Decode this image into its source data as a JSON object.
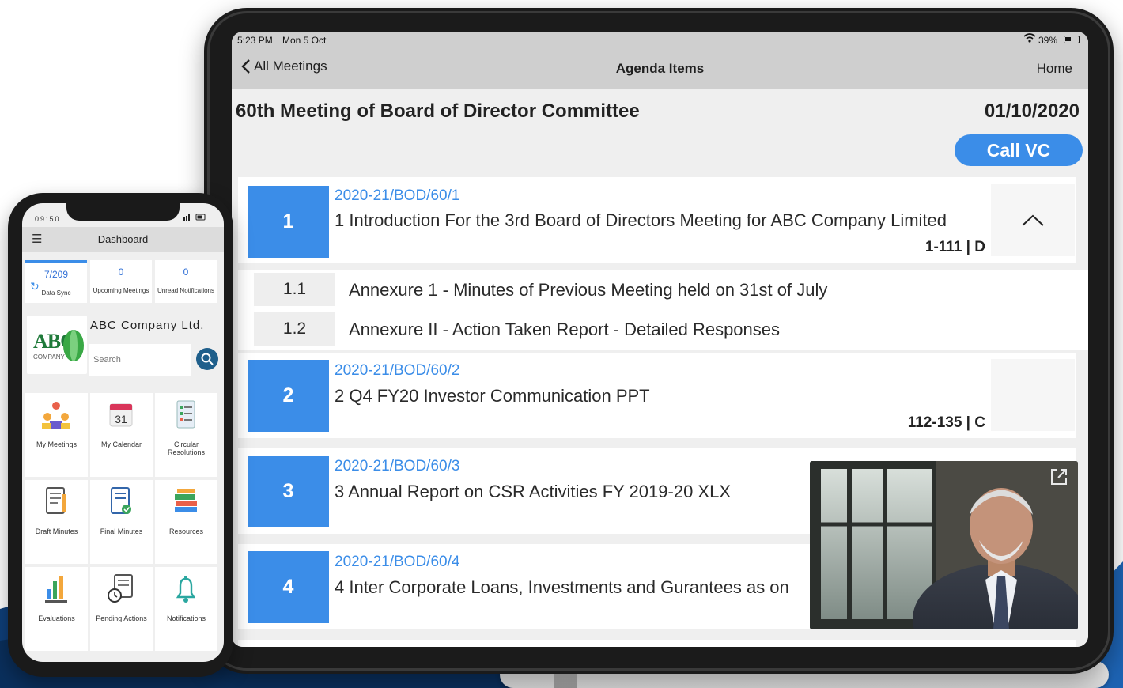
{
  "tablet": {
    "status_bar": {
      "time": "5:23 PM",
      "date": "Mon 5 Oct",
      "battery": "39%"
    },
    "nav": {
      "back_label": "All Meetings",
      "title": "Agenda Items",
      "home_label": "Home"
    },
    "meeting": {
      "title": "60th Meeting of Board of Director Committee",
      "date": "01/10/2020",
      "call_vc_label": "Call VC"
    },
    "agenda_items": [
      {
        "number": "1",
        "ref": "2020-21/BOD/60/1",
        "title": "1 Introduction For the 3rd Board of Directors Meeting for ABC Company Limited",
        "pages": "1-111 | D",
        "expanded": true,
        "sub_items": [
          {
            "number": "1.1",
            "title": "Annexure 1 - Minutes of Previous Meeting held on 31st of July"
          },
          {
            "number": "1.2",
            "title": "Annexure II - Action Taken Report - Detailed Responses"
          }
        ]
      },
      {
        "number": "2",
        "ref": "2020-21/BOD/60/2",
        "title": "2 Q4 FY20 Investor Communication PPT",
        "pages": "112-135 | C"
      },
      {
        "number": "3",
        "ref": "2020-21/BOD/60/3",
        "title": "3 Annual Report on CSR Activities FY 2019-20 XLX"
      },
      {
        "number": "4",
        "ref": "2020-21/BOD/60/4",
        "title": "4 Inter Corporate Loans, Investments and Gurantees as on"
      }
    ],
    "video_popout_icon": "external-link-icon"
  },
  "phone": {
    "status_time": "09:50",
    "header_title": "Dashboard",
    "stats": [
      {
        "value": "7/209",
        "label": "Data Sync"
      },
      {
        "value": "0",
        "label": "Upcoming Meetings"
      },
      {
        "value": "0",
        "label": "Unread Notifications"
      }
    ],
    "company": {
      "name": "ABC Company Ltd.",
      "logo_text": "ABC",
      "logo_subtext": "COMPANY"
    },
    "search_placeholder": "Search",
    "tiles": [
      {
        "label": "My Meetings",
        "icon": "meeting-icon"
      },
      {
        "label": "My Calendar",
        "icon": "calendar-icon",
        "icon_text": "31"
      },
      {
        "label": "Circular Resolutions",
        "icon": "checklist-icon"
      },
      {
        "label": "Draft Minutes",
        "icon": "draft-icon"
      },
      {
        "label": "Final Minutes",
        "icon": "final-doc-icon"
      },
      {
        "label": "Resources",
        "icon": "books-icon"
      },
      {
        "label": "Evaluations",
        "icon": "chart-icon"
      },
      {
        "label": "Pending Actions",
        "icon": "pending-icon"
      },
      {
        "label": "Notifications",
        "icon": "bell-icon"
      }
    ]
  },
  "colors": {
    "accent": "#3b8de8",
    "nav_gray": "#cfcfcf",
    "phone_search_button": "#1f5f8b"
  }
}
